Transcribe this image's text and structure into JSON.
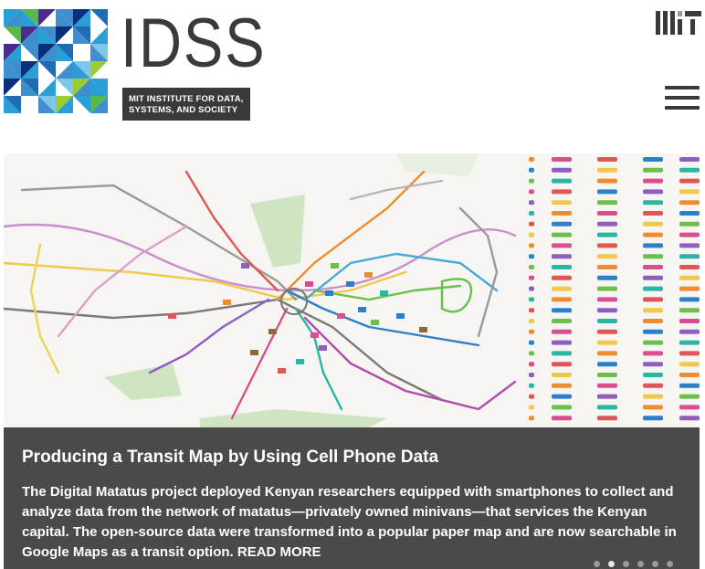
{
  "header": {
    "brand_title": "IDSS",
    "brand_subtitle_line1": "MIT INSTITUTE FOR DATA,",
    "brand_subtitle_line2": "SYSTEMS, AND SOCIETY",
    "mit_logo_icon": "mit-logo",
    "menu_icon": "hamburger-menu-icon"
  },
  "slide": {
    "title": "Producing a Transit Map by Using Cell Phone Data",
    "body": "The Digital Matatus project deployed Kenyan researchers equipped with smartphones to collect and analyze data from the network of matatus—privately owned minivans—that services the Kenyan capital. The open-source data were transformed into a popular paper map and are now searchable in Google Maps as a transit option.",
    "read_more": "READ MORE",
    "dots": 6,
    "active_dot": 2
  },
  "colors": {
    "dark": "#3a3a3a",
    "caption_bg": "#4a4a4a",
    "map_bg": "#f6f5f1",
    "mosaic": [
      "#2a9fd6",
      "#0b2f7a",
      "#9acd32",
      "#3f8fce",
      "#7fc7e8",
      "#4b2b8c",
      "#ffffff",
      "#5ab94c",
      "#1f6bb5"
    ]
  }
}
